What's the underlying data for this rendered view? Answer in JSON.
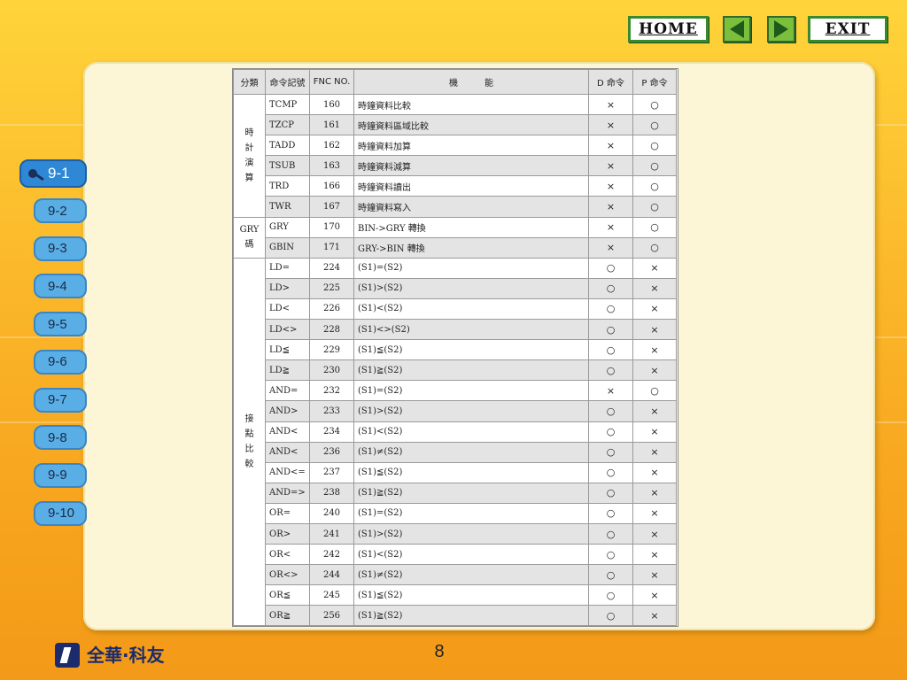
{
  "topnav": {
    "home_label": "HOME",
    "exit_label": "EXIT",
    "prev_icon": "left-triangle",
    "next_icon": "right-triangle"
  },
  "sidebar": {
    "items": [
      {
        "label": "9-1",
        "active": true
      },
      {
        "label": "9-2",
        "active": false
      },
      {
        "label": "9-3",
        "active": false
      },
      {
        "label": "9-4",
        "active": false
      },
      {
        "label": "9-5",
        "active": false
      },
      {
        "label": "9-6",
        "active": false
      },
      {
        "label": "9-7",
        "active": false
      },
      {
        "label": "9-8",
        "active": false
      },
      {
        "label": "9-9",
        "active": false
      },
      {
        "label": "9-10",
        "active": false
      }
    ]
  },
  "table": {
    "headers": [
      "分類",
      "命令記號",
      "FNC NO.",
      "機　　　能",
      "D 命令",
      "P 命令"
    ],
    "groups": [
      {
        "label": "時計演算",
        "start": 0,
        "span": 6
      },
      {
        "label": "GRY碼",
        "start": 6,
        "span": 2
      },
      {
        "label": "接點比較",
        "start": 8,
        "span": 18
      }
    ],
    "rows": [
      {
        "cmd": "TCMP",
        "fnc": "160",
        "func": "時鐘資料比較",
        "d": "×",
        "p": "○"
      },
      {
        "cmd": "TZCP",
        "fnc": "161",
        "func": "時鐘資料區域比較",
        "d": "×",
        "p": "○"
      },
      {
        "cmd": "TADD",
        "fnc": "162",
        "func": "時鐘資料加算",
        "d": "×",
        "p": "○"
      },
      {
        "cmd": "TSUB",
        "fnc": "163",
        "func": "時鐘資料減算",
        "d": "×",
        "p": "○"
      },
      {
        "cmd": "TRD",
        "fnc": "166",
        "func": "時鐘資料讀出",
        "d": "×",
        "p": "○"
      },
      {
        "cmd": "TWR",
        "fnc": "167",
        "func": "時鐘資料寫入",
        "d": "×",
        "p": "○"
      },
      {
        "cmd": "GRY",
        "fnc": "170",
        "func": "BIN->GRY 轉換",
        "d": "×",
        "p": "○"
      },
      {
        "cmd": "GBIN",
        "fnc": "171",
        "func": "GRY->BIN 轉換",
        "d": "×",
        "p": "○"
      },
      {
        "cmd": "LD=",
        "fnc": "224",
        "func": "(S1)=(S2)",
        "d": "○",
        "p": "×"
      },
      {
        "cmd": "LD>",
        "fnc": "225",
        "func": "(S1)>(S2)",
        "d": "○",
        "p": "×"
      },
      {
        "cmd": "LD<",
        "fnc": "226",
        "func": "(S1)<(S2)",
        "d": "○",
        "p": "×"
      },
      {
        "cmd": "LD<>",
        "fnc": "228",
        "func": "(S1)<>(S2)",
        "d": "○",
        "p": "×"
      },
      {
        "cmd": "LD≦",
        "fnc": "229",
        "func": "(S1)≦(S2)",
        "d": "○",
        "p": "×"
      },
      {
        "cmd": "LD≧",
        "fnc": "230",
        "func": "(S1)≧(S2)",
        "d": "○",
        "p": "×"
      },
      {
        "cmd": "AND=",
        "fnc": "232",
        "func": "(S1)=(S2)",
        "d": "×",
        "p": "○"
      },
      {
        "cmd": "AND>",
        "fnc": "233",
        "func": "(S1)>(S2)",
        "d": "○",
        "p": "×"
      },
      {
        "cmd": "AND<",
        "fnc": "234",
        "func": "(S1)<(S2)",
        "d": "○",
        "p": "×"
      },
      {
        "cmd": "AND<",
        "fnc": "236",
        "func": "(S1)≠(S2)",
        "d": "○",
        "p": "×"
      },
      {
        "cmd": "AND<=",
        "fnc": "237",
        "func": "(S1)≦(S2)",
        "d": "○",
        "p": "×"
      },
      {
        "cmd": "AND=>",
        "fnc": "238",
        "func": "(S1)≧(S2)",
        "d": "○",
        "p": "×"
      },
      {
        "cmd": "OR=",
        "fnc": "240",
        "func": "(S1)=(S2)",
        "d": "○",
        "p": "×"
      },
      {
        "cmd": "OR>",
        "fnc": "241",
        "func": "(S1)>(S2)",
        "d": "○",
        "p": "×"
      },
      {
        "cmd": "OR<",
        "fnc": "242",
        "func": "(S1)<(S2)",
        "d": "○",
        "p": "×"
      },
      {
        "cmd": "OR<>",
        "fnc": "244",
        "func": "(S1)≠(S2)",
        "d": "○",
        "p": "×"
      },
      {
        "cmd": "OR≦",
        "fnc": "245",
        "func": "(S1)≦(S2)",
        "d": "○",
        "p": "×"
      },
      {
        "cmd": "OR≧",
        "fnc": "256",
        "func": "(S1)≧(S2)",
        "d": "○",
        "p": "×"
      }
    ]
  },
  "page_number": "8",
  "logo": {
    "name": "全華·科友",
    "icon": "company-logo-icon"
  },
  "colors": {
    "accent_green": "#7bbf3c",
    "tab_blue": "#5aaee6",
    "active_tab_blue": "#2e88d6",
    "panel": "#fcf6d6"
  }
}
